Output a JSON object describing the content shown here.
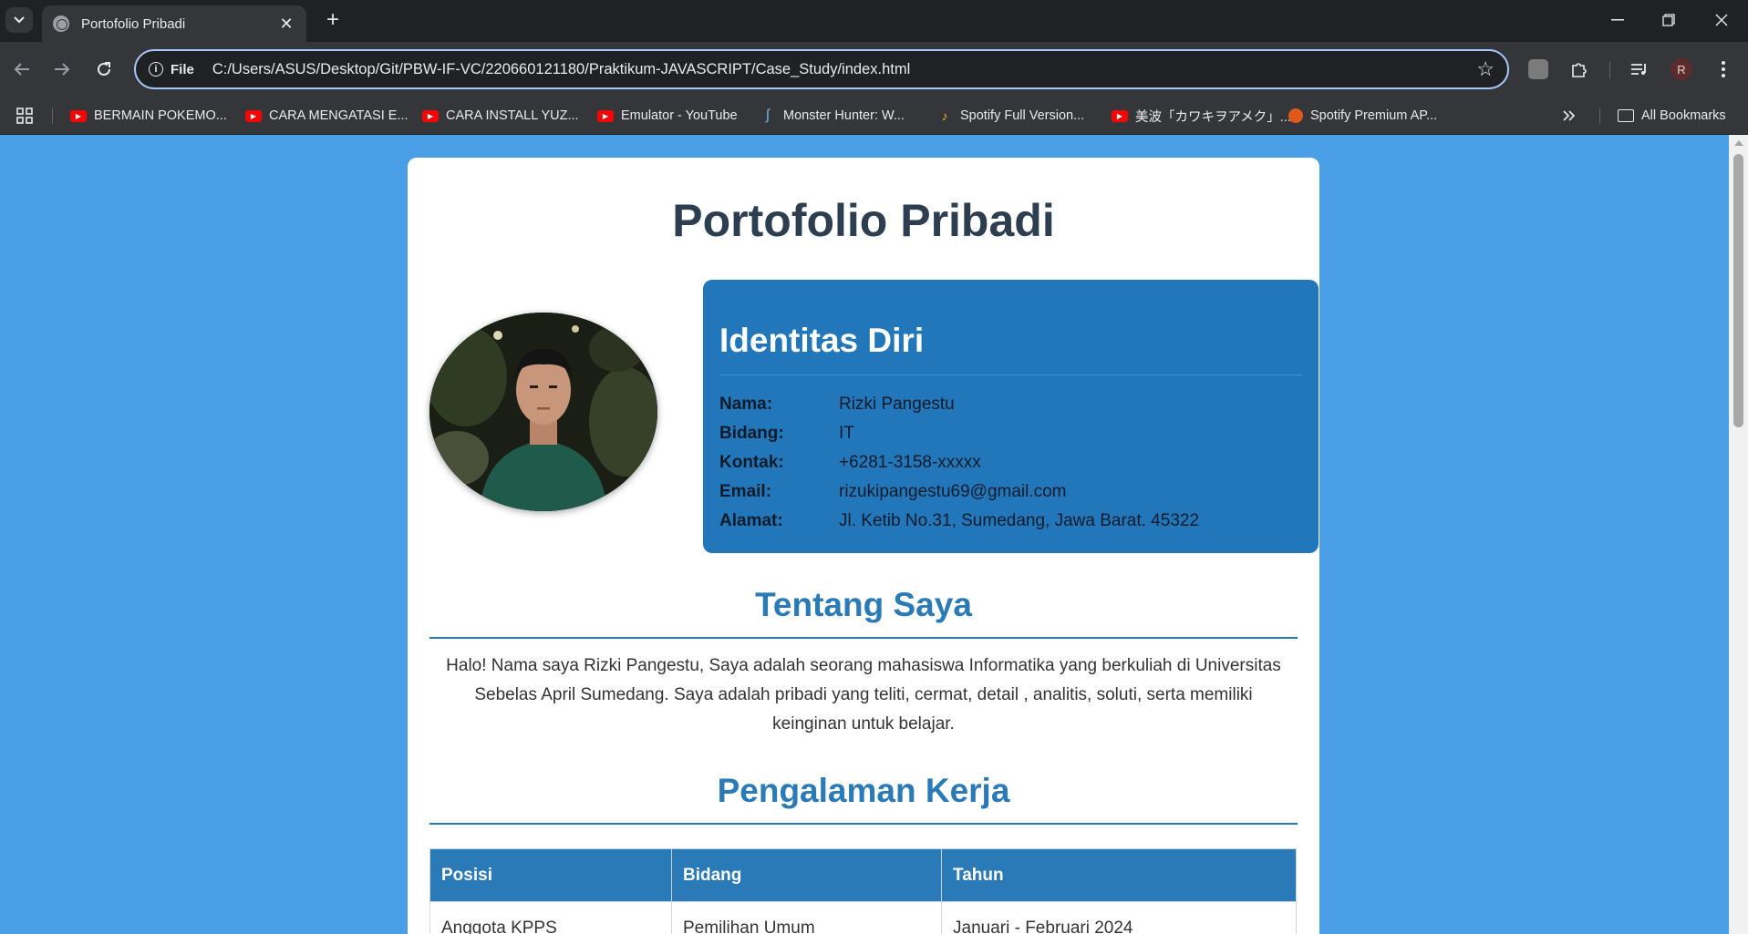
{
  "browser": {
    "tab_title": "Portofolio Pribadi",
    "address": {
      "chip_label": "File",
      "url": "C:/Users/ASUS/Desktop/Git/PBW-IF-VC/220660121180/Praktikum-JAVASCRIPT/Case_Study/index.html"
    },
    "profile_initial": "R",
    "bookmarks": [
      {
        "label": "BERMAIN POKEMO...",
        "icon": "youtube-icon"
      },
      {
        "label": "CARA MENGATASI E...",
        "icon": "youtube-icon"
      },
      {
        "label": "CARA INSTALL YUZ...",
        "icon": "youtube-icon"
      },
      {
        "label": "Emulator - YouTube",
        "icon": "youtube-icon"
      },
      {
        "label": "Monster Hunter: W...",
        "icon": "monster-hunter-icon"
      },
      {
        "label": "Spotify Full Version...",
        "icon": "spotify-icon"
      },
      {
        "label": "美波「カワキヲアメク」...",
        "icon": "youtube-icon"
      },
      {
        "label": "Spotify Premium AP...",
        "icon": "spotify-apk-icon"
      }
    ],
    "all_bookmarks_label": "All Bookmarks"
  },
  "page": {
    "title": "Portofolio Pribadi",
    "identity": {
      "heading": "Identitas Diri",
      "rows": [
        {
          "label": "Nama:",
          "value": "Rizki Pangestu"
        },
        {
          "label": "Bidang:",
          "value": "IT"
        },
        {
          "label": "Kontak:",
          "value": "+6281-3158-xxxxx"
        },
        {
          "label": "Email:",
          "value": "rizukipangestu69@gmail.com"
        },
        {
          "label": "Alamat:",
          "value": "Jl. Ketib No.31, Sumedang, Jawa Barat. 45322"
        }
      ]
    },
    "about": {
      "heading": "Tentang Saya",
      "text": "Halo! Nama saya Rizki Pangestu, Saya adalah seorang mahasiswa Informatika yang berkuliah di Universitas Sebelas April Sumedang. Saya adalah pribadi yang teliti, cermat, detail , analitis, soluti, serta memiliki keinginan untuk belajar."
    },
    "experience": {
      "heading": "Pengalaman Kerja",
      "columns": [
        "Posisi",
        "Bidang",
        "Tahun"
      ],
      "rows": [
        [
          "Anggota KPPS",
          "Pemilihan Umum",
          "Januari - Februari 2024"
        ]
      ]
    }
  },
  "colors": {
    "page_background": "#4a9ee6",
    "identity_panel": "#2277bb",
    "accent": "#2a7ab7",
    "title_text": "#2c3e50"
  }
}
